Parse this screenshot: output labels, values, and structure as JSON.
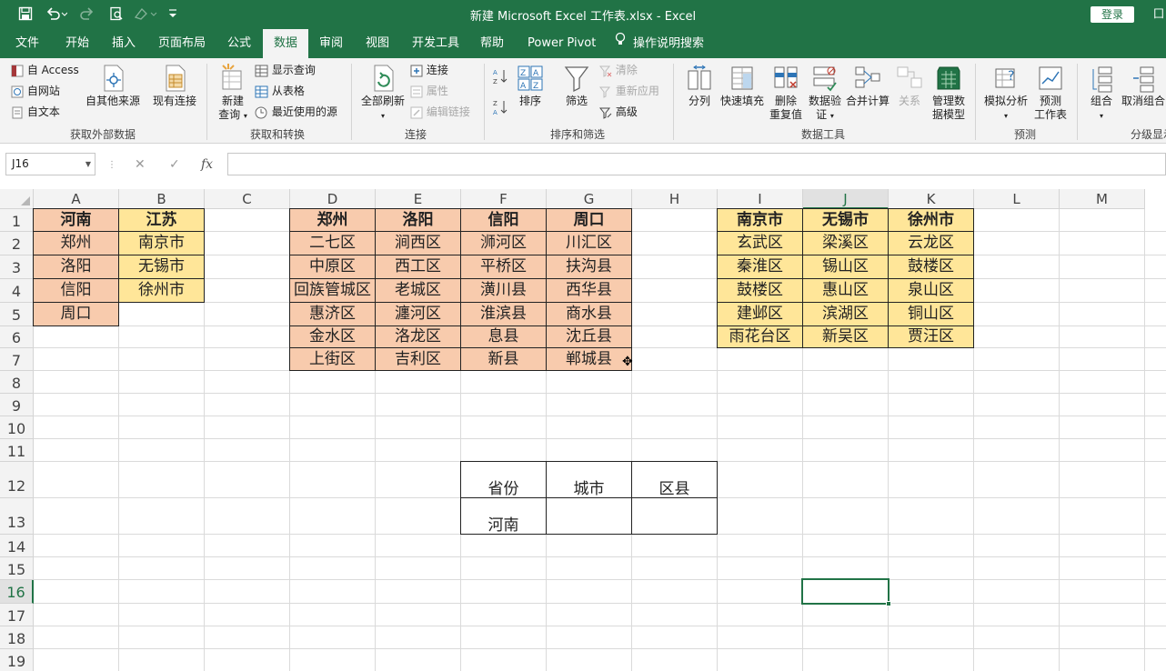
{
  "titlebar": {
    "title": "新建 Microsoft Excel 工作表.xlsx  -  Excel",
    "login": "登录",
    "restore": "囗"
  },
  "menu": {
    "tabs": [
      "文件",
      "开始",
      "插入",
      "页面布局",
      "公式",
      "数据",
      "审阅",
      "视图",
      "开发工具",
      "帮助",
      "Power Pivot"
    ],
    "active": "数据",
    "search": "操作说明搜索"
  },
  "ribbon": {
    "ext": {
      "access": "自 Access",
      "web": "自网站",
      "text": "自文本",
      "other": "自其他来源",
      "existing": "现有连接",
      "label": "获取外部数据"
    },
    "transform": {
      "new_query_1": "新建",
      "new_query_2": "查询",
      "show_query": "显示查询",
      "from_table": "从表格",
      "recent": "最近使用的源",
      "label": "获取和转换"
    },
    "conn": {
      "refresh": "全部刷新",
      "connections": "连接",
      "properties": "属性",
      "edit_links": "编辑链接",
      "label": "连接"
    },
    "sort": {
      "sort": "排序",
      "filter": "筛选",
      "clear": "清除",
      "reapply": "重新应用",
      "advanced": "高级",
      "label": "排序和筛选"
    },
    "tools": {
      "split": "分列",
      "flash": "快速填充",
      "dup_1": "删除",
      "dup_2": "重复值",
      "valid_1": "数据验",
      "valid_2": "证",
      "consolidate": "合并计算",
      "relations": "关系",
      "model_1": "管理数",
      "model_2": "据模型",
      "label": "数据工具"
    },
    "forecast": {
      "whatif": "模拟分析",
      "sheet_1": "预测",
      "sheet_2": "工作表",
      "label": "预测"
    },
    "outline": {
      "group": "组合",
      "ungroup": "取消组合",
      "label": "分级显示"
    }
  },
  "formula_bar": {
    "cell_ref": "J16",
    "cancel": "✕",
    "enter": "✓",
    "fx": "fx",
    "value": ""
  },
  "sheet": {
    "columns": [
      "A",
      "B",
      "C",
      "D",
      "E",
      "F",
      "G",
      "H",
      "I",
      "J",
      "K",
      "L",
      "M"
    ],
    "selected_column": "J",
    "rows": [
      "1",
      "2",
      "3",
      "4",
      "5",
      "6",
      "7",
      "8",
      "9",
      "10",
      "11",
      "12",
      "13",
      "14",
      "15",
      "16",
      "17",
      "18",
      "19"
    ],
    "selected_row": "16",
    "provinces": {
      "A1": "河南",
      "B1": "江苏",
      "A2": "郑州",
      "A3": "洛阳",
      "A4": "信阳",
      "A5": "周口",
      "B2": "南京市",
      "B3": "无锡市",
      "B4": "徐州市"
    },
    "henan_cities": {
      "headers": [
        "郑州",
        "洛阳",
        "信阳",
        "周口"
      ],
      "rows": [
        [
          "二七区",
          "涧西区",
          "浉河区",
          "川汇区"
        ],
        [
          "中原区",
          "西工区",
          "平桥区",
          "扶沟县"
        ],
        [
          "回族管城区",
          "老城区",
          "潢川县",
          "西华县"
        ],
        [
          "惠济区",
          "瀍河区",
          "淮滨县",
          "商水县"
        ],
        [
          "金水区",
          "洛龙区",
          "息县",
          "沈丘县"
        ],
        [
          "上街区",
          "吉利区",
          "新县",
          "郸城县"
        ]
      ]
    },
    "jiangsu_cities": {
      "headers": [
        "南京市",
        "无锡市",
        "徐州市"
      ],
      "rows": [
        [
          "玄武区",
          "梁溪区",
          "云龙区"
        ],
        [
          "秦淮区",
          "锡山区",
          "鼓楼区"
        ],
        [
          "鼓楼区",
          "惠山区",
          "泉山区"
        ],
        [
          "建邺区",
          "滨湖区",
          "铜山区"
        ],
        [
          "雨花台区",
          "新吴区",
          "贾汪区"
        ]
      ]
    },
    "lookup": {
      "headers": [
        "省份",
        "城市",
        "区县"
      ],
      "values": [
        "河南",
        "",
        ""
      ]
    }
  }
}
